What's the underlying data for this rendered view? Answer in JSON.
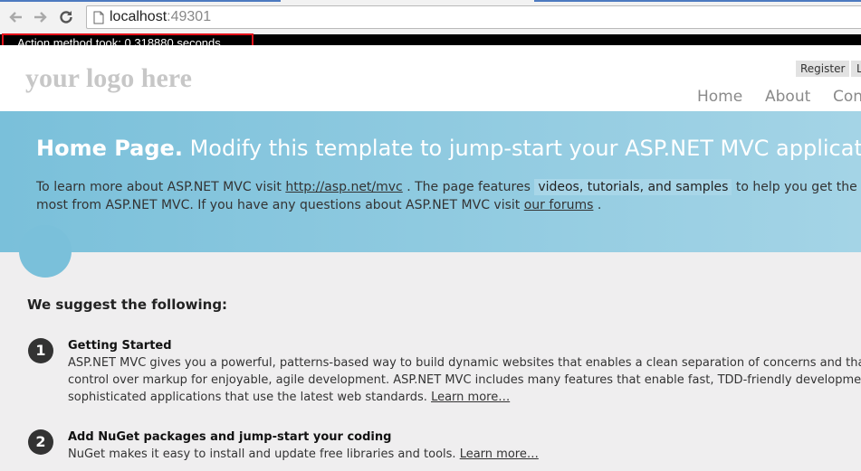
{
  "browser": {
    "url_host": "localhost",
    "url_port": ":49301"
  },
  "profiler": {
    "text": "Action method took: 0.318880 seconds"
  },
  "header": {
    "logo": "your logo here",
    "auth": {
      "register": "Register",
      "login": "L"
    },
    "menu": [
      "Home",
      "About",
      "Con"
    ]
  },
  "featured": {
    "title_bold": "Home Page.",
    "title_rest": " Modify this template to jump-start your ASP.NET MVC application.",
    "text1": "To learn more about ASP.NET MVC visit ",
    "link1": "http://asp.net/mvc",
    "text2": " . The page features ",
    "highlight": "videos, tutorials, and samples",
    "text3": " to help you get the most from ASP.NET MVC. If you have any questions about ASP.NET MVC visit ",
    "link2": "our forums",
    "text4": " ."
  },
  "content": {
    "suggest_heading": "We suggest the following:",
    "items": [
      {
        "number": "1",
        "title": "Getting Started",
        "lines": [
          "ASP.NET MVC gives you a powerful, patterns-based way to build dynamic websites that enables a clean separation of concerns and that gives you full",
          "control over markup for enjoyable, agile development. ASP.NET MVC includes many features that enable fast, TDD-friendly development for creating",
          "sophisticated applications that use the latest web standards. "
        ],
        "link": "Learn more…"
      },
      {
        "number": "2",
        "title": "Add NuGet packages and jump-start your coding",
        "lines": [
          "NuGet makes it easy to install and update free libraries and tools. "
        ],
        "link": "Learn more…"
      }
    ]
  }
}
